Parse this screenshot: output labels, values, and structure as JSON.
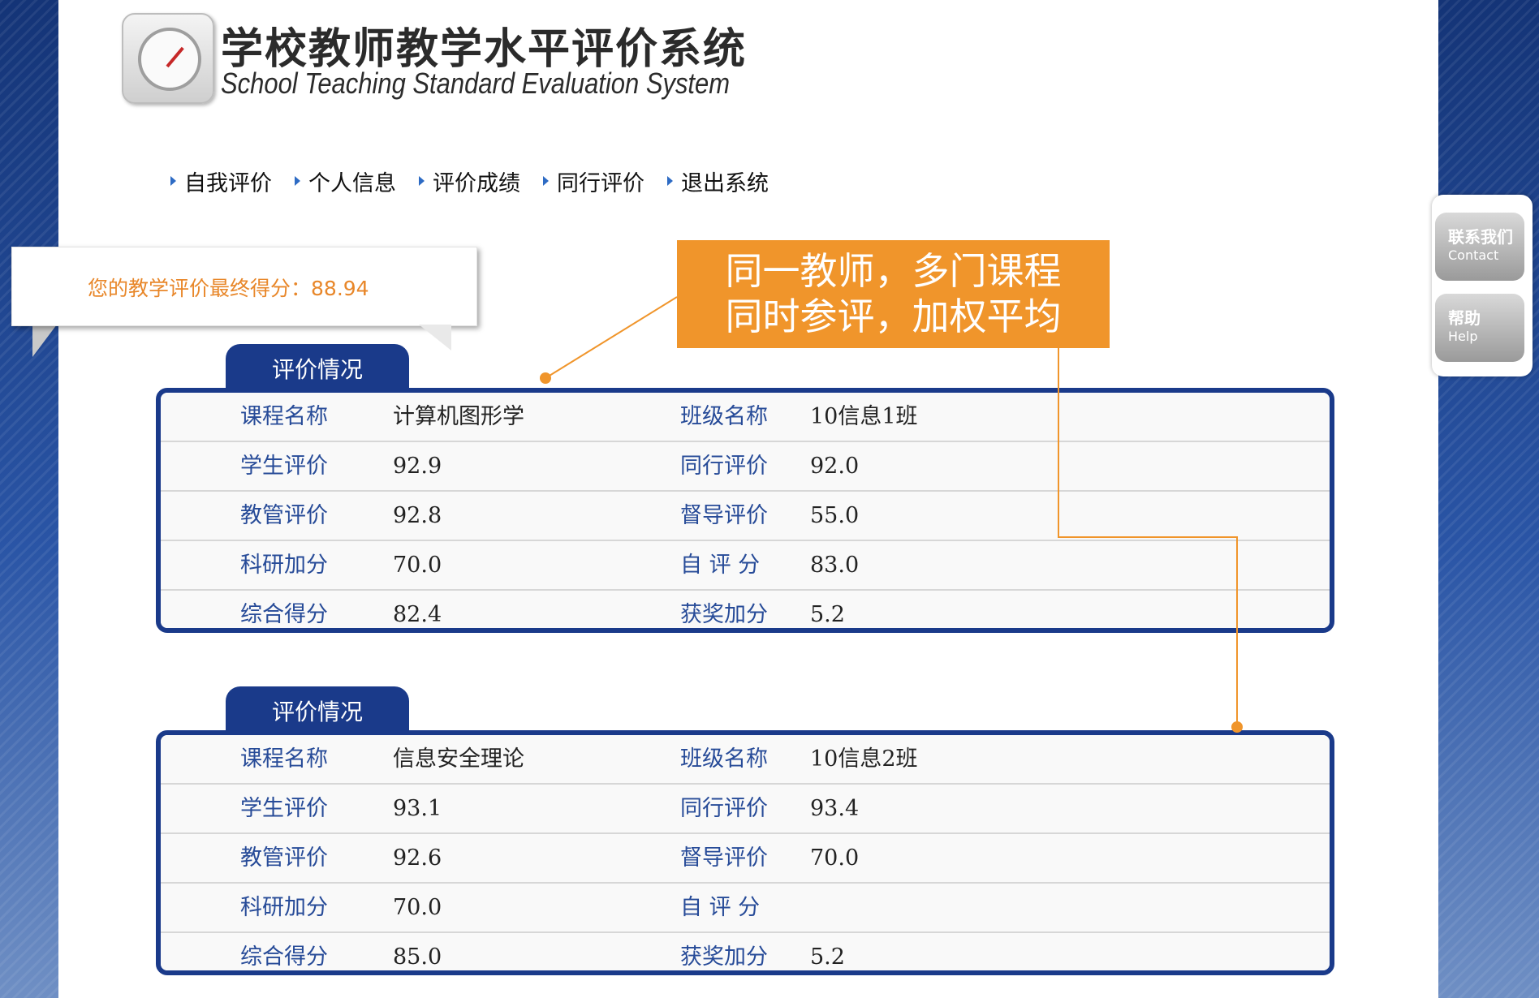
{
  "header": {
    "title_cn": "学校教师教学水平评价系统",
    "title_en": "School Teaching Standard Evaluation System",
    "logo_icon": "gauge-icon"
  },
  "nav": {
    "items": [
      {
        "label": "自我评价"
      },
      {
        "label": "个人信息"
      },
      {
        "label": "评价成绩"
      },
      {
        "label": "同行评价"
      },
      {
        "label": "退出系统"
      }
    ]
  },
  "score": {
    "text": "您的教学评价最终得分：88.94"
  },
  "callout": {
    "line1": "同一教师，多门课程",
    "line2": "同时参评，加权平均",
    "color": "#f0952b"
  },
  "panels": [
    {
      "tab": "评价情况",
      "rows": [
        {
          "l1": "课程名称",
          "v1": "计算机图形学",
          "l2": "班级名称",
          "v2": "10信息1班"
        },
        {
          "l1": "学生评价",
          "v1": "92.9",
          "l2": "同行评价",
          "v2": "92.0"
        },
        {
          "l1": "教管评价",
          "v1": "92.8",
          "l2": "督导评价",
          "v2": "55.0"
        },
        {
          "l1": "科研加分",
          "v1": "70.0",
          "l2": "自 评 分",
          "v2": "83.0"
        },
        {
          "l1": "综合得分",
          "v1": "82.4",
          "l2": "获奖加分",
          "v2": "5.2"
        }
      ]
    },
    {
      "tab": "评价情况",
      "rows": [
        {
          "l1": "课程名称",
          "v1": "信息安全理论",
          "l2": "班级名称",
          "v2": "10信息2班"
        },
        {
          "l1": "学生评价",
          "v1": "93.1",
          "l2": "同行评价",
          "v2": "93.4"
        },
        {
          "l1": "教管评价",
          "v1": "92.6",
          "l2": "督导评价",
          "v2": "70.0"
        },
        {
          "l1": "科研加分",
          "v1": "70.0",
          "l2": "自 评 分",
          "v2": ""
        },
        {
          "l1": "综合得分",
          "v1": "85.0",
          "l2": "获奖加分",
          "v2": "5.2"
        }
      ]
    }
  ],
  "side": {
    "contact_cn": "联系我们",
    "contact_en": "Contact",
    "help_cn": "帮助",
    "help_en": "Help"
  },
  "colors": {
    "panel_border": "#1a3a8a",
    "score_text": "#e8872a",
    "label_text": "#274b98"
  }
}
